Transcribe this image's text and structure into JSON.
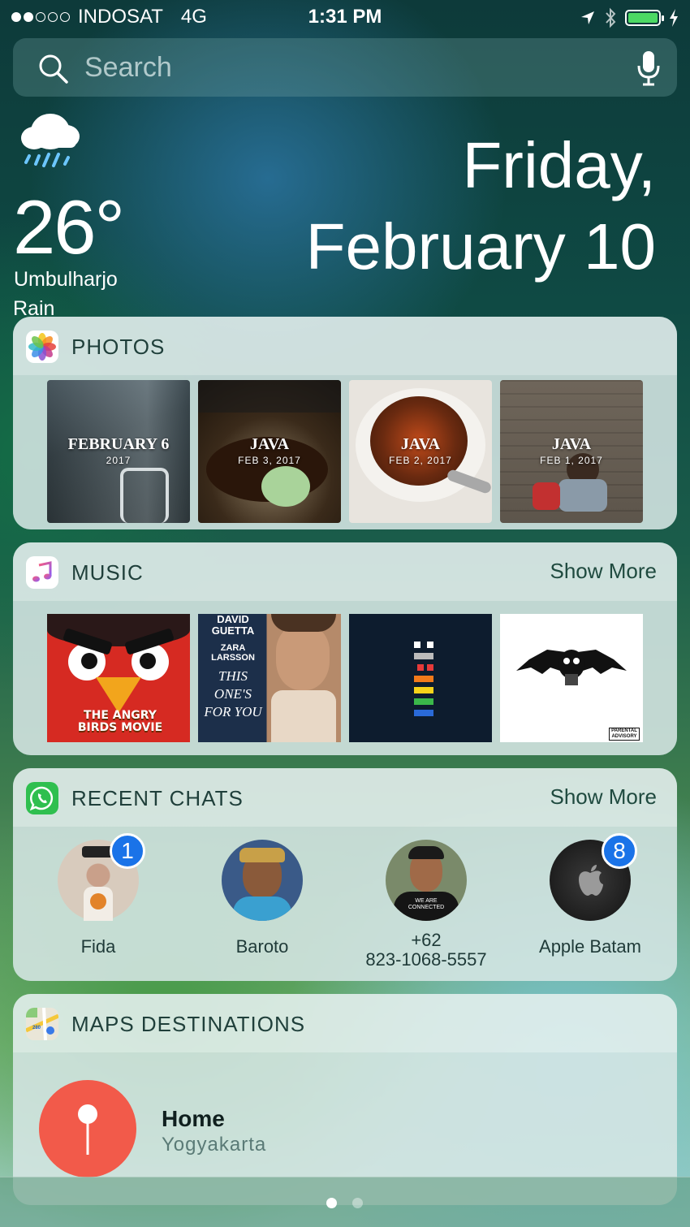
{
  "status_bar": {
    "carrier": "INDOSAT",
    "network": "4G",
    "time": "1:31 PM",
    "signal_bars_filled": 2,
    "signal_bars_total": 5,
    "battery_color": "#4cd964"
  },
  "search": {
    "placeholder": "Search"
  },
  "weather": {
    "icon": "rain-cloud-icon",
    "temperature": "26°",
    "location": "Umbulharjo",
    "condition": "Rain"
  },
  "date": {
    "weekday": "Friday,",
    "day": "February 10"
  },
  "photos": {
    "title": "PHOTOS",
    "items": [
      {
        "title": "FEBRUARY 6",
        "subtitle": "2017"
      },
      {
        "title": "JAVA",
        "subtitle": "FEB 3, 2017"
      },
      {
        "title": "JAVA",
        "subtitle": "FEB 2, 2017"
      },
      {
        "title": "JAVA",
        "subtitle": "FEB 1, 2017"
      }
    ]
  },
  "music": {
    "title": "MUSIC",
    "show_more": "Show More",
    "albums": [
      {
        "text": "THE ANGRY BIRDS MOVIE"
      },
      {
        "artist": "DAVID GUETTA",
        "feat": "ZARA LARSSON",
        "song": "THIS ONE'S FOR YOU"
      },
      {
        "text": ""
      },
      {
        "text": "PARENTAL ADVISORY"
      }
    ]
  },
  "recent_chats": {
    "title": "RECENT CHATS",
    "show_more": "Show More",
    "chats": [
      {
        "name": "Fida",
        "badge": "1"
      },
      {
        "name": "Baroto",
        "badge": ""
      },
      {
        "name_line1": "+62",
        "name_line2": "823-1068-5557",
        "badge": "",
        "shirt_text": "WE ARE CONNECTED"
      },
      {
        "name": "Apple Batam",
        "badge": "8"
      }
    ]
  },
  "maps": {
    "title": "MAPS DESTINATIONS",
    "icon_text": "280",
    "destination": "Home",
    "destination_sub": "Yogyakarta"
  },
  "pager": {
    "active_page": 1,
    "total_pages": 2
  }
}
